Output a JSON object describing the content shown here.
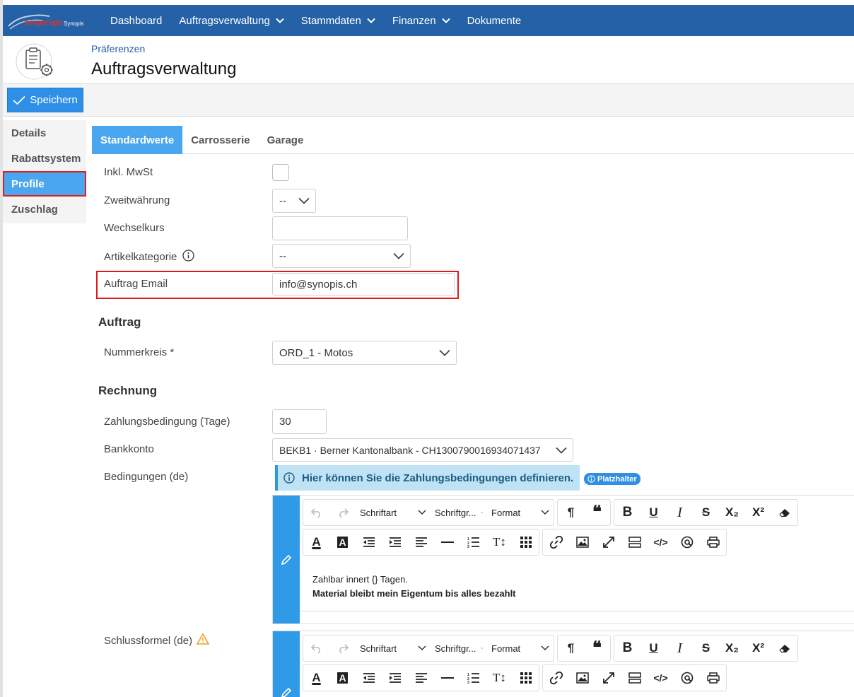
{
  "nav": {
    "logo_text": "sesgarage",
    "logo_sub": "Synopis",
    "items": [
      {
        "label": "Dashboard",
        "has_menu": false
      },
      {
        "label": "Auftragsverwaltung",
        "has_menu": true
      },
      {
        "label": "Stammdaten",
        "has_menu": true
      },
      {
        "label": "Finanzen",
        "has_menu": true
      },
      {
        "label": "Dokumente",
        "has_menu": false
      }
    ],
    "color": "#2461a6"
  },
  "header": {
    "breadcrumb": "Präferenzen",
    "title": "Auftragsverwaltung"
  },
  "toolbar": {
    "save_label": "Speichern"
  },
  "sidemenu": {
    "items": [
      {
        "label": "Details"
      },
      {
        "label": "Rabattsystem"
      },
      {
        "label": "Profile",
        "active": true
      },
      {
        "label": "Zuschlag"
      }
    ]
  },
  "tabs": [
    {
      "label": "Standardwerte",
      "active": true
    },
    {
      "label": "Carrosserie"
    },
    {
      "label": "Garage"
    }
  ],
  "form": {
    "inkl_mwst_label": "Inkl. MwSt",
    "inkl_mwst_checked": false,
    "zweitwaehrung_label": "Zweitwährung",
    "zweitwaehrung_value": "--",
    "wechselkurs_label": "Wechselkurs",
    "wechselkurs_value": "",
    "artikelkategorie_label": "Artikelkategorie",
    "artikelkategorie_value": "--",
    "auftrag_email_label": "Auftrag Email",
    "auftrag_email_value": "info@synopis.ch"
  },
  "auftrag": {
    "section_title": "Auftrag",
    "nummernkreis_label": "Nummerkreis *",
    "nummernkreis_value": "ORD_1 - Motos"
  },
  "rechnung": {
    "section_title": "Rechnung",
    "zahlungsbedingung_label": "Zahlungsbedingung (Tage)",
    "zahlungsbedingung_value": "30",
    "bankkonto_label": "Bankkonto",
    "bankkonto_value": "BEKB1 · Berner Kantonalbank - CH1300790016934071437",
    "bedingungen_label": "Bedingungen (de)",
    "info_text": "Hier können Sie die Zahlungsbedingungen definieren.",
    "placeholder_badge": "Platzhalter",
    "bedingungen_line1": "Zahlbar innert {} Tagen.",
    "bedingungen_line2": "Material bleibt mein Eigentum bis alles bezahlt",
    "schlussformel_label": "Schlussformel (de)"
  },
  "editor_toolbar": {
    "font_label": "Schriftart",
    "size_label": "Schriftgr...",
    "format_label": "Format",
    "subscript_label": "X₂",
    "superscript_label": "X²",
    "clear_format_label": "eraser"
  }
}
